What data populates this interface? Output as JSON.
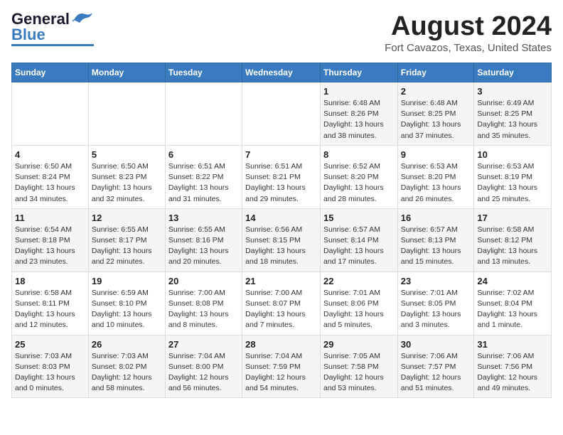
{
  "header": {
    "logo_general": "General",
    "logo_blue": "Blue",
    "title": "August 2024",
    "location": "Fort Cavazos, Texas, United States"
  },
  "weekdays": [
    "Sunday",
    "Monday",
    "Tuesday",
    "Wednesday",
    "Thursday",
    "Friday",
    "Saturday"
  ],
  "weeks": [
    [
      {
        "day": "",
        "info": ""
      },
      {
        "day": "",
        "info": ""
      },
      {
        "day": "",
        "info": ""
      },
      {
        "day": "",
        "info": ""
      },
      {
        "day": "1",
        "info": "Sunrise: 6:48 AM\nSunset: 8:26 PM\nDaylight: 13 hours\nand 38 minutes."
      },
      {
        "day": "2",
        "info": "Sunrise: 6:48 AM\nSunset: 8:25 PM\nDaylight: 13 hours\nand 37 minutes."
      },
      {
        "day": "3",
        "info": "Sunrise: 6:49 AM\nSunset: 8:25 PM\nDaylight: 13 hours\nand 35 minutes."
      }
    ],
    [
      {
        "day": "4",
        "info": "Sunrise: 6:50 AM\nSunset: 8:24 PM\nDaylight: 13 hours\nand 34 minutes."
      },
      {
        "day": "5",
        "info": "Sunrise: 6:50 AM\nSunset: 8:23 PM\nDaylight: 13 hours\nand 32 minutes."
      },
      {
        "day": "6",
        "info": "Sunrise: 6:51 AM\nSunset: 8:22 PM\nDaylight: 13 hours\nand 31 minutes."
      },
      {
        "day": "7",
        "info": "Sunrise: 6:51 AM\nSunset: 8:21 PM\nDaylight: 13 hours\nand 29 minutes."
      },
      {
        "day": "8",
        "info": "Sunrise: 6:52 AM\nSunset: 8:20 PM\nDaylight: 13 hours\nand 28 minutes."
      },
      {
        "day": "9",
        "info": "Sunrise: 6:53 AM\nSunset: 8:20 PM\nDaylight: 13 hours\nand 26 minutes."
      },
      {
        "day": "10",
        "info": "Sunrise: 6:53 AM\nSunset: 8:19 PM\nDaylight: 13 hours\nand 25 minutes."
      }
    ],
    [
      {
        "day": "11",
        "info": "Sunrise: 6:54 AM\nSunset: 8:18 PM\nDaylight: 13 hours\nand 23 minutes."
      },
      {
        "day": "12",
        "info": "Sunrise: 6:55 AM\nSunset: 8:17 PM\nDaylight: 13 hours\nand 22 minutes."
      },
      {
        "day": "13",
        "info": "Sunrise: 6:55 AM\nSunset: 8:16 PM\nDaylight: 13 hours\nand 20 minutes."
      },
      {
        "day": "14",
        "info": "Sunrise: 6:56 AM\nSunset: 8:15 PM\nDaylight: 13 hours\nand 18 minutes."
      },
      {
        "day": "15",
        "info": "Sunrise: 6:57 AM\nSunset: 8:14 PM\nDaylight: 13 hours\nand 17 minutes."
      },
      {
        "day": "16",
        "info": "Sunrise: 6:57 AM\nSunset: 8:13 PM\nDaylight: 13 hours\nand 15 minutes."
      },
      {
        "day": "17",
        "info": "Sunrise: 6:58 AM\nSunset: 8:12 PM\nDaylight: 13 hours\nand 13 minutes."
      }
    ],
    [
      {
        "day": "18",
        "info": "Sunrise: 6:58 AM\nSunset: 8:11 PM\nDaylight: 13 hours\nand 12 minutes."
      },
      {
        "day": "19",
        "info": "Sunrise: 6:59 AM\nSunset: 8:10 PM\nDaylight: 13 hours\nand 10 minutes."
      },
      {
        "day": "20",
        "info": "Sunrise: 7:00 AM\nSunset: 8:08 PM\nDaylight: 13 hours\nand 8 minutes."
      },
      {
        "day": "21",
        "info": "Sunrise: 7:00 AM\nSunset: 8:07 PM\nDaylight: 13 hours\nand 7 minutes."
      },
      {
        "day": "22",
        "info": "Sunrise: 7:01 AM\nSunset: 8:06 PM\nDaylight: 13 hours\nand 5 minutes."
      },
      {
        "day": "23",
        "info": "Sunrise: 7:01 AM\nSunset: 8:05 PM\nDaylight: 13 hours\nand 3 minutes."
      },
      {
        "day": "24",
        "info": "Sunrise: 7:02 AM\nSunset: 8:04 PM\nDaylight: 13 hours\nand 1 minute."
      }
    ],
    [
      {
        "day": "25",
        "info": "Sunrise: 7:03 AM\nSunset: 8:03 PM\nDaylight: 13 hours\nand 0 minutes."
      },
      {
        "day": "26",
        "info": "Sunrise: 7:03 AM\nSunset: 8:02 PM\nDaylight: 12 hours\nand 58 minutes."
      },
      {
        "day": "27",
        "info": "Sunrise: 7:04 AM\nSunset: 8:00 PM\nDaylight: 12 hours\nand 56 minutes."
      },
      {
        "day": "28",
        "info": "Sunrise: 7:04 AM\nSunset: 7:59 PM\nDaylight: 12 hours\nand 54 minutes."
      },
      {
        "day": "29",
        "info": "Sunrise: 7:05 AM\nSunset: 7:58 PM\nDaylight: 12 hours\nand 53 minutes."
      },
      {
        "day": "30",
        "info": "Sunrise: 7:06 AM\nSunset: 7:57 PM\nDaylight: 12 hours\nand 51 minutes."
      },
      {
        "day": "31",
        "info": "Sunrise: 7:06 AM\nSunset: 7:56 PM\nDaylight: 12 hours\nand 49 minutes."
      }
    ]
  ]
}
